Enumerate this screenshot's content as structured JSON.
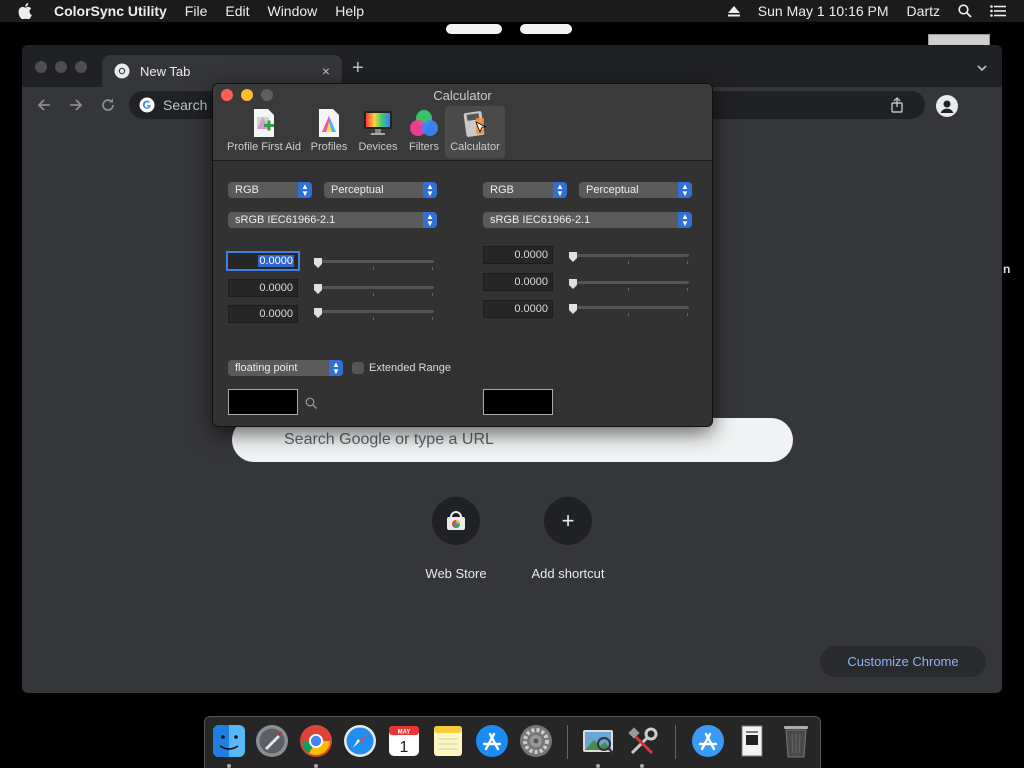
{
  "menubar": {
    "app_name": "ColorSync Utility",
    "menus": [
      "File",
      "Edit",
      "Window",
      "Help"
    ],
    "clock": "Sun May 1  10:16 PM",
    "user": "Dartz"
  },
  "desktop": {
    "edge_text": "n"
  },
  "chrome": {
    "tab_title": "New Tab",
    "new_tab_symbol": "+",
    "tab_close_symbol": "×",
    "omnibox_placeholder": "Search Google or type a URL",
    "omnibox_visible_text": "Search",
    "shortcuts": [
      {
        "label": "Web Store"
      },
      {
        "label": "Add shortcut",
        "symbol": "+"
      }
    ],
    "customize_label": "Customize Chrome"
  },
  "colorsync": {
    "title": "Calculator",
    "toolbar": [
      {
        "label": "Profile First Aid"
      },
      {
        "label": "Profiles"
      },
      {
        "label": "Devices"
      },
      {
        "label": "Filters"
      },
      {
        "label": "Calculator",
        "selected": true
      }
    ],
    "left": {
      "color_space": "RGB",
      "intent": "Perceptual",
      "profile": "sRGB IEC61966-2.1",
      "values": [
        "0.0000",
        "0.0000",
        "0.0000"
      ],
      "slider_levels": [
        0,
        0,
        0
      ]
    },
    "right": {
      "color_space": "RGB",
      "intent": "Perceptual",
      "profile": "sRGB IEC61966-2.1",
      "values": [
        "0.0000",
        "0.0000",
        "0.0000"
      ],
      "slider_levels": [
        0,
        0,
        0
      ]
    },
    "format": "floating point",
    "extended_range_label": "Extended Range",
    "extended_range_checked": false,
    "left_swatch_color": "#000000",
    "right_swatch_color": "#000000"
  },
  "dock": {
    "items": [
      "finder",
      "launchpad",
      "chrome",
      "safari",
      "calendar",
      "notes",
      "app-store",
      "system-preferences",
      "colorsync-utility",
      "utilities",
      "app-store-downloads",
      "documents-stack",
      "trash"
    ],
    "calendar_month": "MAY",
    "calendar_day": "1"
  }
}
